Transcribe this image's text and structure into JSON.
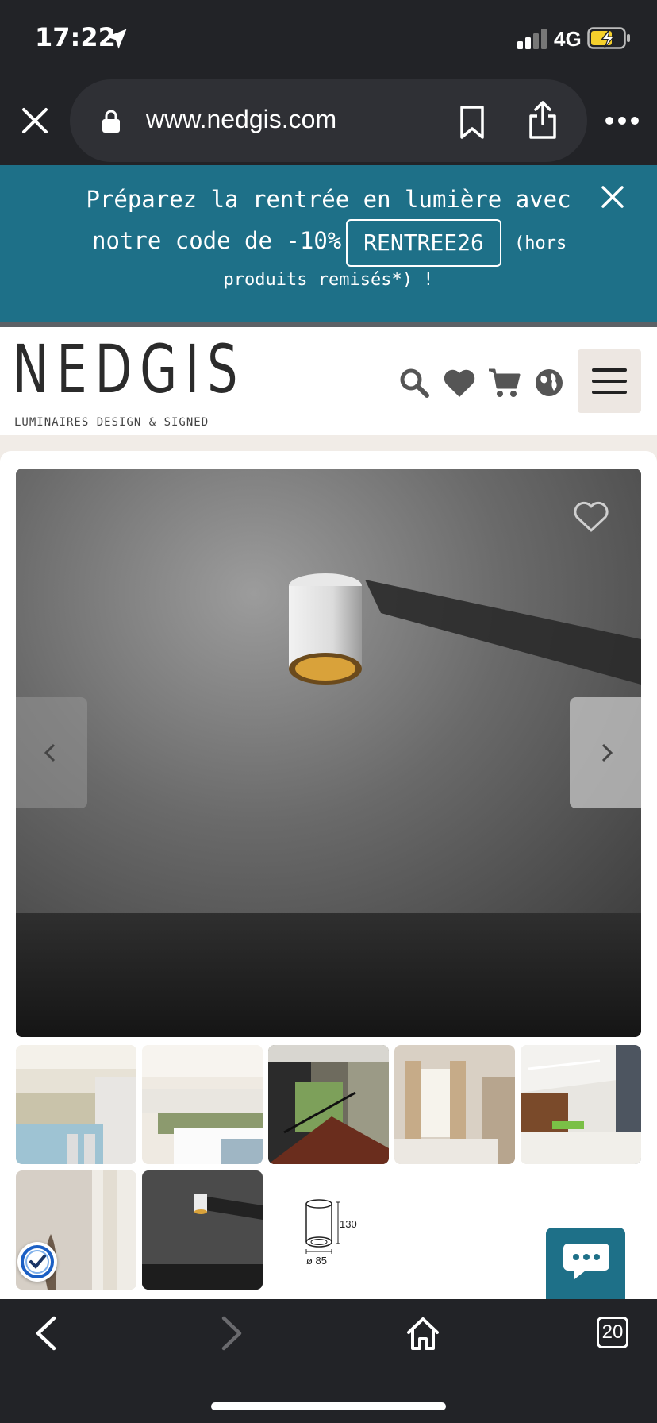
{
  "status": {
    "time": "17:22",
    "network": "4G"
  },
  "browser": {
    "url": "www.nedgis.com",
    "tab_count": "20"
  },
  "promo": {
    "line1": "Préparez la rentrée en lumière avec",
    "line2_prefix": "notre code de -10%",
    "code": "RENTREE26",
    "line2_suffix": "(hors",
    "line3": "produits remisés*) !"
  },
  "site": {
    "logo": "NEDGIS",
    "tagline": "LUMINAIRES DESIGN & SIGNED"
  },
  "product": {
    "dims": {
      "height": "130",
      "diameter": "ø 85"
    }
  },
  "colors": {
    "banner": "#1e7088",
    "chrome": "#222327",
    "accent_gold": "#d9a23a"
  }
}
